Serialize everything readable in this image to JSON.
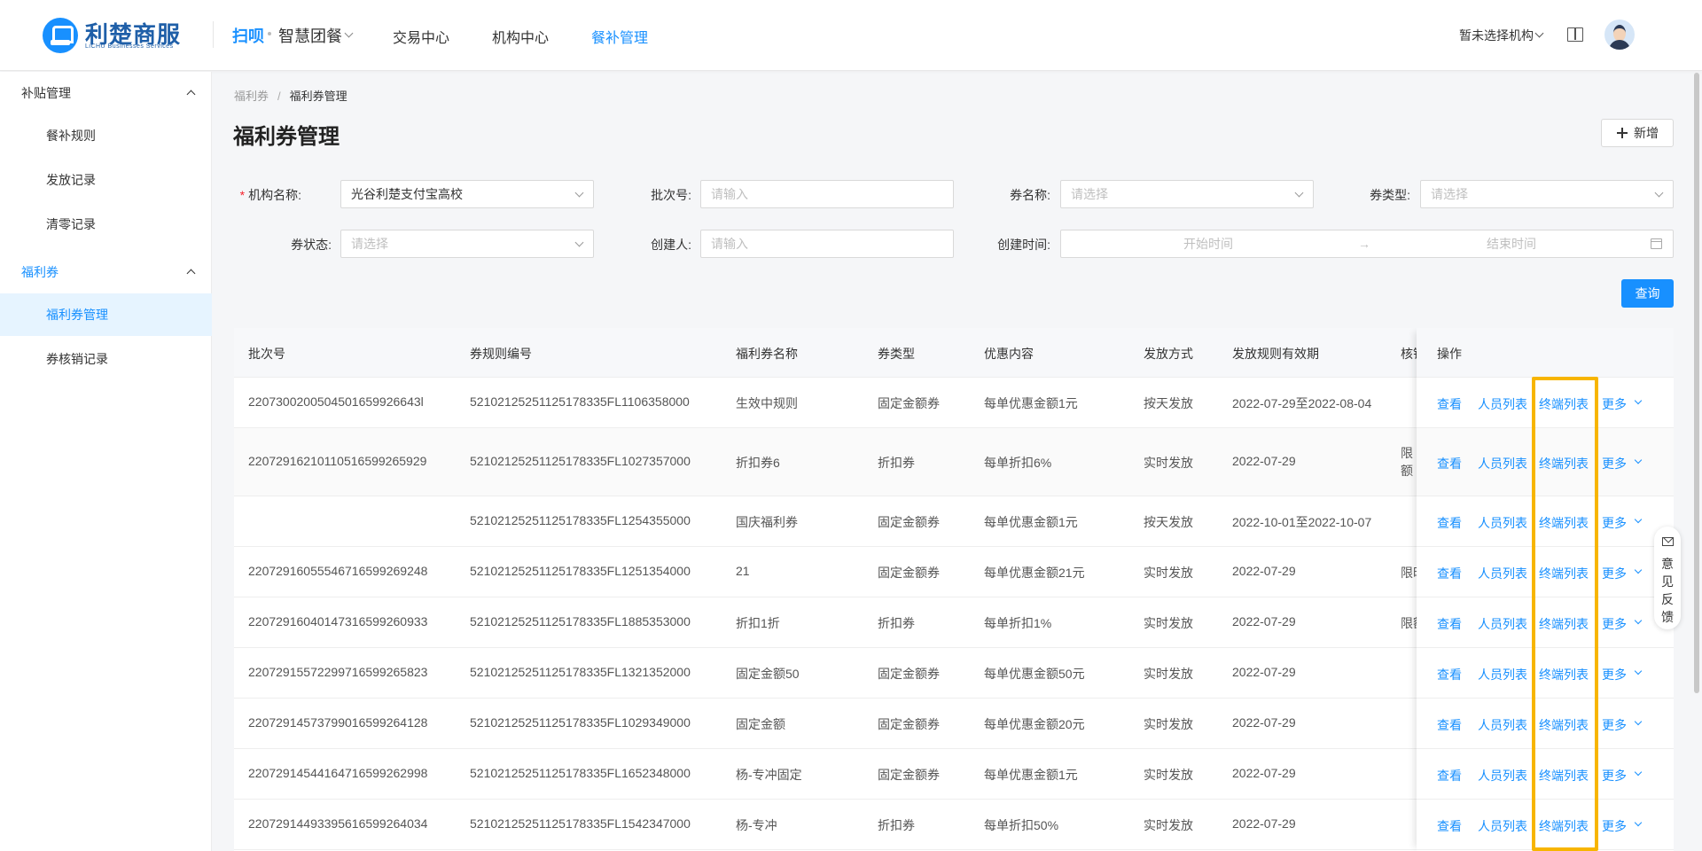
{
  "header": {
    "logo_main": "利楚商服",
    "logo_sub": "LiCHU Businesses Services",
    "brand": "扫呗",
    "brand_menu": "智慧团餐",
    "nav": [
      "交易中心",
      "机构中心",
      "餐补管理"
    ],
    "nav_active": "餐补管理",
    "org_select": "暂未选择机构"
  },
  "sidebar": {
    "groups": [
      {
        "label": "补贴管理",
        "items": [
          "餐补规则",
          "发放记录",
          "清零记录"
        ]
      },
      {
        "label": "福利券",
        "items": [
          "福利券管理",
          "券核销记录"
        ]
      }
    ],
    "active_item": "福利券管理"
  },
  "breadcrumb": {
    "parent": "福利券",
    "sep": "/",
    "current": "福利券管理"
  },
  "page": {
    "title": "福利券管理",
    "add_label": "新增"
  },
  "filters": {
    "org_label": "机构名称:",
    "org_value": "光谷利楚支付宝高校",
    "batch_label": "批次号:",
    "batch_placeholder": "请输入",
    "coupon_name_label": "券名称:",
    "coupon_name_placeholder": "请选择",
    "coupon_type_label": "券类型:",
    "coupon_type_placeholder": "请选择",
    "status_label": "券状态:",
    "status_placeholder": "请选择",
    "creator_label": "创建人:",
    "creator_placeholder": "请输入",
    "created_label": "创建时间:",
    "start_placeholder": "开始时间",
    "date_arrow": "→",
    "end_placeholder": "结束时间",
    "query_label": "查询"
  },
  "table": {
    "columns": [
      "批次号",
      "券规则编号",
      "福利券名称",
      "券类型",
      "优惠内容",
      "发放方式",
      "发放规则有效期",
      "核销",
      "操作"
    ],
    "rows": [
      {
        "batch": "2207300200504501659926643l",
        "rule": "5210212525112517833​5FL1106358000",
        "name": "生效中规则",
        "type": "固定金额券",
        "discount": "每单优惠金额1元",
        "method": "按天发放",
        "validity": "2022-07-29至2022-08-04",
        "extra": ""
      },
      {
        "batch": "220729162101105165992659​29",
        "rule": "52102125251125178335FL1027357000",
        "name": "折扣券6",
        "type": "折扣券",
        "discount": "每单折扣6%",
        "method": "实时发放",
        "validity": "2022-07-29",
        "extra": "限额 限时"
      },
      {
        "batch": "",
        "rule": "52102125251125178335FL1254355000",
        "name": "国庆福利券",
        "type": "固定金额券",
        "discount": "每单优惠金额1元",
        "method": "按天发放",
        "validity": "2022-10-01至2022-10-07",
        "extra": ""
      },
      {
        "batch": "2207291605554671659926​9248",
        "rule": "52102125251125178335FL1251354000",
        "name": "21",
        "type": "固定金额券",
        "discount": "每单优惠金额21元",
        "method": "实时发放",
        "validity": "2022-07-29",
        "extra": "限时"
      },
      {
        "batch": "2207291604014731659926​0933",
        "rule": "52102125251125178335FL1885353000",
        "name": "折扣1折",
        "type": "折扣券",
        "discount": "每单折扣1%",
        "method": "实时发放",
        "validity": "2022-07-29",
        "extra": "限额"
      },
      {
        "batch": "2207291557229971659926​5823",
        "rule": "52102125251125178335FL1321352000",
        "name": "固定金额50",
        "type": "固定金额券",
        "discount": "每单优惠金额50元",
        "method": "实时发放",
        "validity": "2022-07-29",
        "extra": ""
      },
      {
        "batch": "2207291457379901659926​4128",
        "rule": "52102125251125178335FL1029349000",
        "name": "固定金额",
        "type": "固定金额券",
        "discount": "每单优惠金额20元",
        "method": "实时发放",
        "validity": "2022-07-29",
        "extra": ""
      },
      {
        "batch": "2207291454416471659926​2998",
        "rule": "52102125251125178335FL1652348000",
        "name": "杨-专冲固定",
        "type": "固定金额券",
        "discount": "每单优惠金额1元",
        "method": "实时发放",
        "validity": "2022-07-29",
        "extra": ""
      },
      {
        "batch": "2207291449339561659926​4034",
        "rule": "52102125251125178335FL1542347000",
        "name": "杨-专冲",
        "type": "折扣券",
        "discount": "每单折扣50%",
        "method": "实时发放",
        "validity": "2022-07-29",
        "extra": ""
      }
    ],
    "actions": {
      "view": "查看",
      "people": "人员列表",
      "terminals": "终端列表",
      "more": "更多"
    }
  },
  "feedback": {
    "label": "意见反馈",
    "chars": [
      "意",
      "见",
      "反",
      "馈"
    ]
  },
  "colors": {
    "primary": "#1890ff",
    "highlight": "#f7b500",
    "required": "#f5222d"
  }
}
